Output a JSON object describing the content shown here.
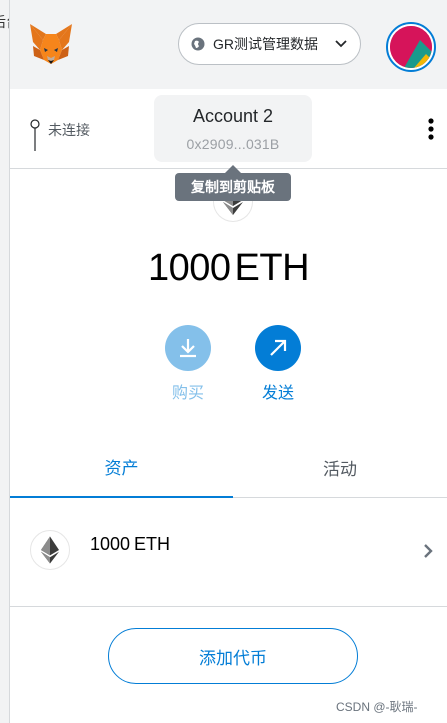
{
  "left_strip": {
    "clipped_text": "后台"
  },
  "header": {
    "network_label": "GR测试管理数据"
  },
  "account_bar": {
    "connection_status": "未连接",
    "account_name": "Account 2",
    "account_address": "0x2909...031B",
    "tooltip": "复制到剪贴板"
  },
  "balance": {
    "amount": "1000",
    "unit": "ETH"
  },
  "actions": {
    "buy_label": "购买",
    "send_label": "发送"
  },
  "tabs": {
    "assets_label": "资产",
    "activity_label": "活动",
    "active": "assets"
  },
  "assets": [
    {
      "amount": "1000",
      "symbol": "ETH"
    }
  ],
  "add_token_label": "添加代币",
  "watermark": "CSDN @-耿瑞-",
  "colors": {
    "primary": "#037dd6",
    "primary_light": "#84c0ea",
    "header_bg": "#f2f3f4",
    "tooltip_bg": "#6a737d"
  }
}
